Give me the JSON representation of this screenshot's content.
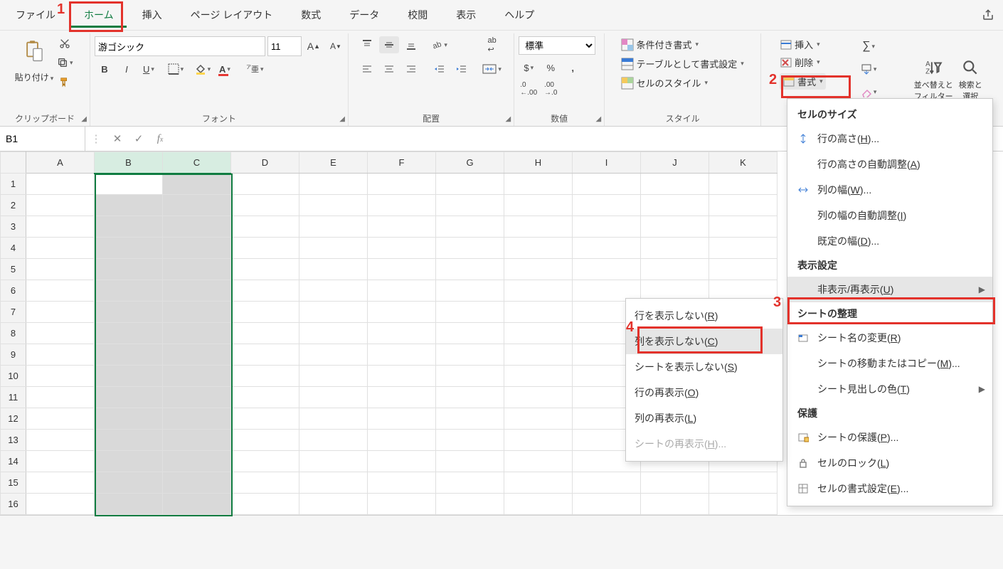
{
  "tabs": {
    "file": "ファイル",
    "home": "ホーム",
    "insert": "挿入",
    "layout": "ページ レイアウト",
    "formula": "数式",
    "data": "データ",
    "review": "校閲",
    "view": "表示",
    "help": "ヘルプ"
  },
  "ribbon": {
    "clipboard_label": "クリップボード",
    "paste_label": "貼り付け",
    "font_label": "フォント",
    "font_name": "游ゴシック",
    "font_size": "11",
    "align_label": "配置",
    "wrap_label": "ab",
    "number_label": "数値",
    "number_format": "標準",
    "styles_label": "スタイル",
    "cond_format": "条件付き書式",
    "table_format": "テーブルとして書式設定",
    "cell_styles": "セルのスタイル",
    "cells_insert": "挿入",
    "cells_delete": "削除",
    "cells_format": "書式",
    "sort_filter": "並べ替えと\nフィルター",
    "find_select": "検索と\n選択"
  },
  "namebox_value": "B1",
  "formula_value": "",
  "columns": [
    "A",
    "B",
    "C",
    "D",
    "E",
    "F",
    "G",
    "H",
    "I",
    "J",
    "K"
  ],
  "selected_cols": [
    "B",
    "C"
  ],
  "row_count": 16,
  "active_cell": "B1",
  "format_menu": {
    "cell_size_header": "セルのサイズ",
    "row_height": "行の高さ(<u>H</u>)...",
    "autofit_row": "行の高さの自動調整(<u>A</u>)",
    "col_width": "列の幅(<u>W</u>)...",
    "autofit_col": "列の幅の自動調整(<u>I</u>)",
    "default_width": "既定の幅(<u>D</u>)...",
    "visibility_header": "表示設定",
    "hide_unhide": "非表示/再表示(<u>U</u>)",
    "sheet_header": "シートの整理",
    "rename_sheet": "シート名の変更(<u>R</u>)",
    "move_copy": "シートの移動またはコピー(<u>M</u>)...",
    "tab_color": "シート見出しの色(<u>T</u>)",
    "protect_header": "保護",
    "protect_sheet": "シートの保護(<u>P</u>)...",
    "lock_cell": "セルのロック(<u>L</u>)",
    "format_cells": "セルの書式設定(<u>E</u>)..."
  },
  "hide_submenu": {
    "hide_rows": "行を表示しない(<u>R</u>)",
    "hide_cols": "列を表示しない(<u>C</u>)",
    "hide_sheet": "シートを表示しない(<u>S</u>)",
    "unhide_rows": "行の再表示(<u>O</u>)",
    "unhide_cols": "列の再表示(<u>L</u>)",
    "unhide_sheet": "シートの再表示(<u>H</u>)..."
  },
  "annotations": {
    "n1": "1",
    "n2": "2",
    "n3": "3",
    "n4": "4"
  }
}
